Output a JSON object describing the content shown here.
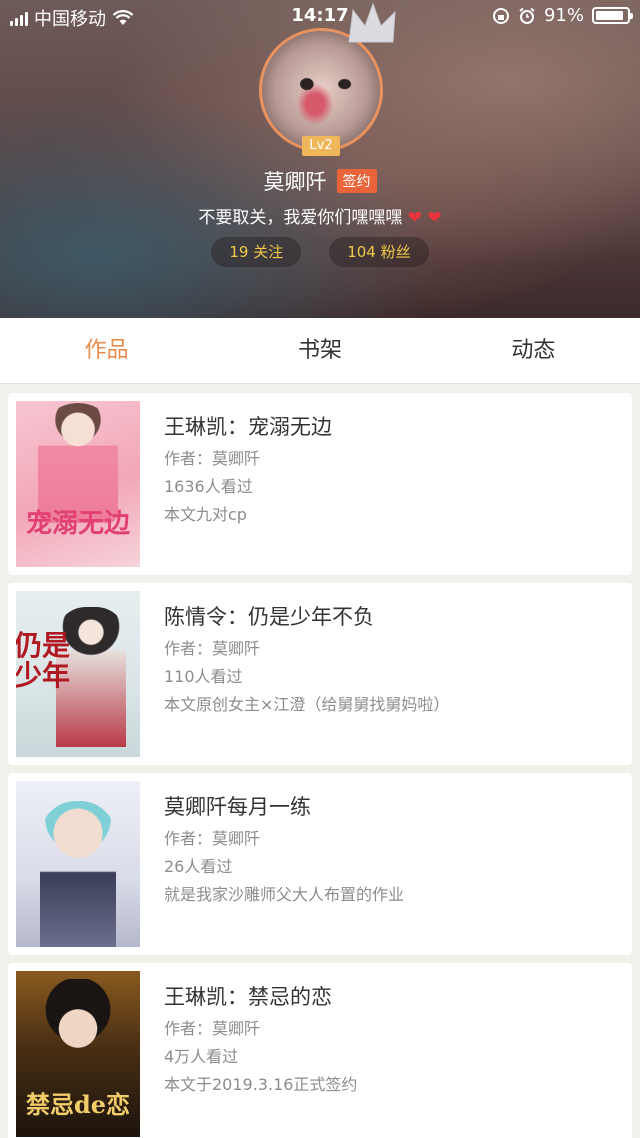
{
  "status_bar": {
    "carrier": "中国移动",
    "time": "14:17",
    "battery": "91%",
    "battery_level": 0.91
  },
  "profile": {
    "level": "Lv2",
    "name": "莫卿阡",
    "sign_badge": "签约",
    "bio": "不要取关，我爱你们嘿嘿嘿",
    "following": "19 关注",
    "followers": "104 粉丝"
  },
  "tabs": [
    {
      "label": "作品",
      "active": true
    },
    {
      "label": "书架",
      "active": false
    },
    {
      "label": "动态",
      "active": false
    }
  ],
  "works": [
    {
      "title": "王琳凯：宠溺无边",
      "author": "作者：莫卿阡",
      "views": "1636人看过",
      "desc": "本文九对cp",
      "cover_text": "宠溺无边"
    },
    {
      "title": "陈情令：仍是少年不负",
      "author": "作者：莫卿阡",
      "views": "110人看过",
      "desc": "本文原创女主×江澄（给舅舅找舅妈啦）",
      "cover_text": "仍是少年"
    },
    {
      "title": "莫卿阡每月一练",
      "author": "作者：莫卿阡",
      "views": "26人看过",
      "desc": "就是我家沙雕师父大人布置的作业",
      "cover_text": ""
    },
    {
      "title": "王琳凯：禁忌的恋",
      "author": "作者：莫卿阡",
      "views": "4万人看过",
      "desc": "本文于2019.3.16正式签约",
      "cover_text": "禁忌de恋"
    }
  ],
  "colors": {
    "accent": "#e88c4b",
    "sign_badge": "#e9643a",
    "level_badge": "#f0b65a",
    "stat_text": "#f0c84a"
  }
}
